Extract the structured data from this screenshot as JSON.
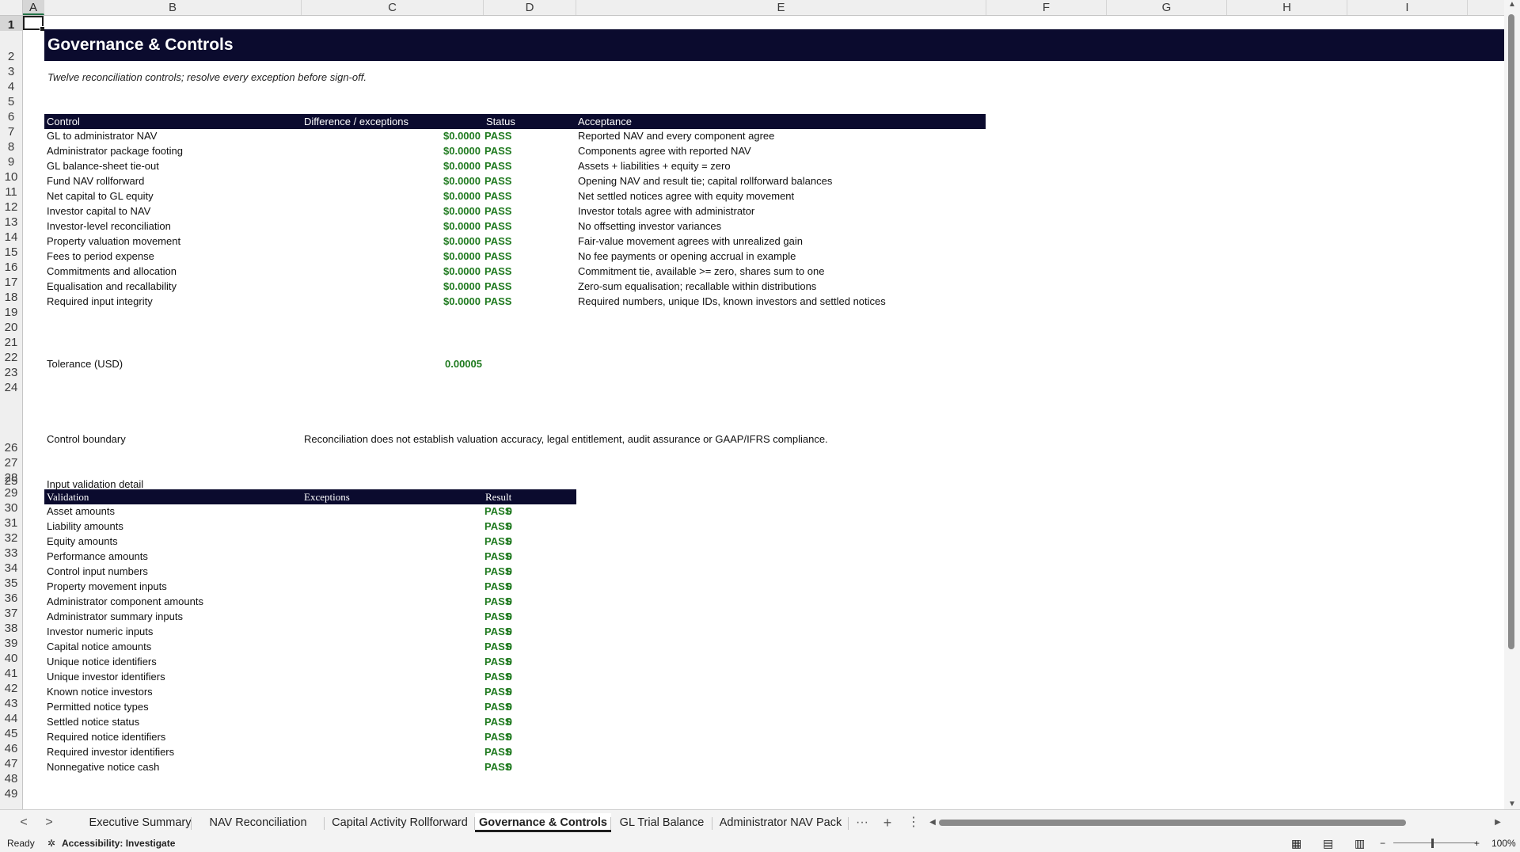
{
  "columns": [
    "A",
    "B",
    "C",
    "D",
    "E",
    "F",
    "G",
    "H",
    "I"
  ],
  "rows": [
    "1",
    "2",
    "3",
    "4",
    "5",
    "6",
    "7",
    "8",
    "9",
    "10",
    "11",
    "12",
    "13",
    "14",
    "15",
    "16",
    "17",
    "18",
    "19",
    "20",
    "21",
    "22",
    "23",
    "24",
    "25",
    "26",
    "27",
    "28",
    "29",
    "30",
    "31",
    "32",
    "33",
    "34",
    "35",
    "36",
    "37",
    "38",
    "39",
    "40",
    "41",
    "42",
    "43",
    "44",
    "45",
    "46",
    "47",
    "48",
    "49"
  ],
  "sheet": {
    "title": "Governance & Controls",
    "subtitle": "Twelve reconciliation controls; resolve every exception before sign-off.",
    "controls_header": {
      "control": "Control",
      "difference": "Difference / exceptions",
      "status": "Status",
      "acceptance": "Acceptance"
    },
    "controls": [
      {
        "name": "GL to administrator NAV",
        "difference": "$0.0000",
        "status": "PASS",
        "acceptance": "Reported NAV and every component agree"
      },
      {
        "name": "Administrator package footing",
        "difference": "$0.0000",
        "status": "PASS",
        "acceptance": "Components agree with reported NAV"
      },
      {
        "name": "GL balance-sheet tie-out",
        "difference": "$0.0000",
        "status": "PASS",
        "acceptance": "Assets + liabilities + equity = zero"
      },
      {
        "name": "Fund NAV rollforward",
        "difference": "$0.0000",
        "status": "PASS",
        "acceptance": "Opening NAV and result tie; capital rollforward balances"
      },
      {
        "name": "Net capital to GL equity",
        "difference": "$0.0000",
        "status": "PASS",
        "acceptance": "Net settled notices agree with equity movement"
      },
      {
        "name": "Investor capital to NAV",
        "difference": "$0.0000",
        "status": "PASS",
        "acceptance": "Investor totals agree with administrator"
      },
      {
        "name": "Investor-level reconciliation",
        "difference": "$0.0000",
        "status": "PASS",
        "acceptance": "No offsetting investor variances"
      },
      {
        "name": "Property valuation movement",
        "difference": "$0.0000",
        "status": "PASS",
        "acceptance": "Fair-value movement agrees with unrealized gain"
      },
      {
        "name": "Fees to period expense",
        "difference": "$0.0000",
        "status": "PASS",
        "acceptance": "No fee payments or opening accrual in example"
      },
      {
        "name": "Commitments and allocation",
        "difference": "$0.0000",
        "status": "PASS",
        "acceptance": "Commitment tie, available >= zero, shares sum to one"
      },
      {
        "name": "Equalisation and recallability",
        "difference": "$0.0000",
        "status": "PASS",
        "acceptance": "Zero-sum equalisation; recallable within distributions"
      },
      {
        "name": "Required input integrity",
        "difference": "$0.0000",
        "status": "PASS",
        "acceptance": "Required numbers, unique IDs, known investors and settled notices"
      }
    ],
    "tolerance_label": "Tolerance (USD)",
    "tolerance_value": "0.00005",
    "boundary_label": "Control boundary",
    "boundary_text": "Reconciliation does not establish valuation accuracy, legal entitlement, audit assurance or GAAP/IFRS compliance.",
    "validation_title": "Input validation detail",
    "validation_header": {
      "validation": "Validation",
      "exceptions": "Exceptions",
      "result": "Result"
    },
    "validations": [
      {
        "name": "Asset amounts",
        "count": "0",
        "result": "PASS"
      },
      {
        "name": "Liability amounts",
        "count": "0",
        "result": "PASS"
      },
      {
        "name": "Equity amounts",
        "count": "0",
        "result": "PASS"
      },
      {
        "name": "Performance amounts",
        "count": "0",
        "result": "PASS"
      },
      {
        "name": "Control input numbers",
        "count": "0",
        "result": "PASS"
      },
      {
        "name": "Property movement inputs",
        "count": "0",
        "result": "PASS"
      },
      {
        "name": "Administrator component amounts",
        "count": "0",
        "result": "PASS"
      },
      {
        "name": "Administrator summary inputs",
        "count": "0",
        "result": "PASS"
      },
      {
        "name": "Investor numeric inputs",
        "count": "0",
        "result": "PASS"
      },
      {
        "name": "Capital notice amounts",
        "count": "0",
        "result": "PASS"
      },
      {
        "name": "Unique notice identifiers",
        "count": "0",
        "result": "PASS"
      },
      {
        "name": "Unique investor identifiers",
        "count": "0",
        "result": "PASS"
      },
      {
        "name": "Known notice investors",
        "count": "0",
        "result": "PASS"
      },
      {
        "name": "Permitted notice types",
        "count": "0",
        "result": "PASS"
      },
      {
        "name": "Settled notice status",
        "count": "0",
        "result": "PASS"
      },
      {
        "name": "Required notice identifiers",
        "count": "0",
        "result": "PASS"
      },
      {
        "name": "Required investor identifiers",
        "count": "0",
        "result": "PASS"
      },
      {
        "name": "Nonnegative notice cash",
        "count": "0",
        "result": "PASS"
      }
    ]
  },
  "tabs": [
    "Executive Summary",
    "NAV Reconciliation",
    "Capital Activity Rollforward",
    "Governance & Controls",
    "GL Trial Balance",
    "Administrator NAV Pack"
  ],
  "active_tab": "Governance & Controls",
  "tab_controls": {
    "more": "···",
    "add": "+",
    "options": "⋮",
    "prev": "<",
    "next": ">"
  },
  "status": {
    "ready": "Ready",
    "accessibility": "Accessibility: Investigate",
    "zoom": "100%"
  },
  "colors": {
    "header_band": "#0b0b2e",
    "pass_green": "#1f7a1f"
  }
}
